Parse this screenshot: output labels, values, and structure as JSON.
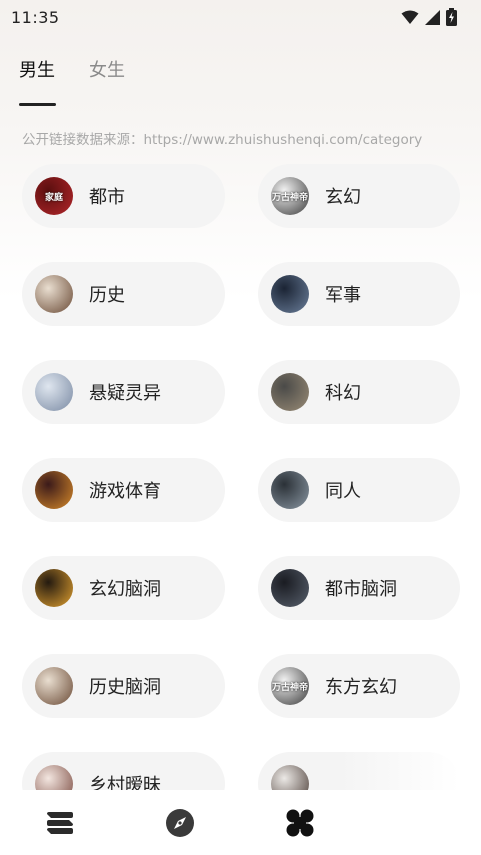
{
  "status_bar": {
    "time": "11:35",
    "icons": [
      "wifi-icon",
      "cellular-signal-icon",
      "battery-charging-icon"
    ]
  },
  "tabs": [
    {
      "label": "男生",
      "active": true
    },
    {
      "label": "女生",
      "active": false
    }
  ],
  "source_note": "公开链接数据来源：https://www.zhuishushenqi.com/category",
  "categories": [
    {
      "label": "都市",
      "cover_text": "家庭",
      "cover_colors": [
        "#5a0f0f",
        "#b3262a"
      ]
    },
    {
      "label": "玄幻",
      "cover_text": "万古神帝",
      "cover_colors": [
        "#f2f2f2",
        "#3a3a3a"
      ]
    },
    {
      "label": "历史",
      "cover_text": "",
      "cover_colors": [
        "#e9ded0",
        "#6a4a35"
      ]
    },
    {
      "label": "军事",
      "cover_text": "",
      "cover_colors": [
        "#1b2434",
        "#6b7f9b"
      ]
    },
    {
      "label": "悬疑灵异",
      "cover_text": "",
      "cover_colors": [
        "#dfe6ef",
        "#7a8aa3"
      ]
    },
    {
      "label": "科幻",
      "cover_text": "",
      "cover_colors": [
        "#4a4a48",
        "#9a8c76"
      ]
    },
    {
      "label": "游戏体育",
      "cover_text": "",
      "cover_colors": [
        "#3b1a1a",
        "#d68a2a"
      ]
    },
    {
      "label": "同人",
      "cover_text": "",
      "cover_colors": [
        "#2b3137",
        "#8a97a3"
      ]
    },
    {
      "label": "玄幻脑洞",
      "cover_text": "",
      "cover_colors": [
        "#241a10",
        "#e0a030"
      ]
    },
    {
      "label": "都市脑洞",
      "cover_text": "",
      "cover_colors": [
        "#1a1c22",
        "#58606d"
      ]
    },
    {
      "label": "历史脑洞",
      "cover_text": "",
      "cover_colors": [
        "#e9ded0",
        "#6a4a35"
      ]
    },
    {
      "label": "东方玄幻",
      "cover_text": "万古神帝",
      "cover_colors": [
        "#f2f2f2",
        "#3a3a3a"
      ]
    },
    {
      "label": "乡村暧昧",
      "cover_text": "",
      "cover_colors": [
        "#f3e6e0",
        "#7a4a40"
      ]
    },
    {
      "label": "",
      "cover_text": "",
      "cover_colors": [
        "#ece9e6",
        "#4a3c36"
      ]
    }
  ],
  "bottom_nav": [
    {
      "name": "bookshelf-icon",
      "active": false
    },
    {
      "name": "compass-icon",
      "active": false
    },
    {
      "name": "category-grid-icon",
      "active": true
    }
  ]
}
